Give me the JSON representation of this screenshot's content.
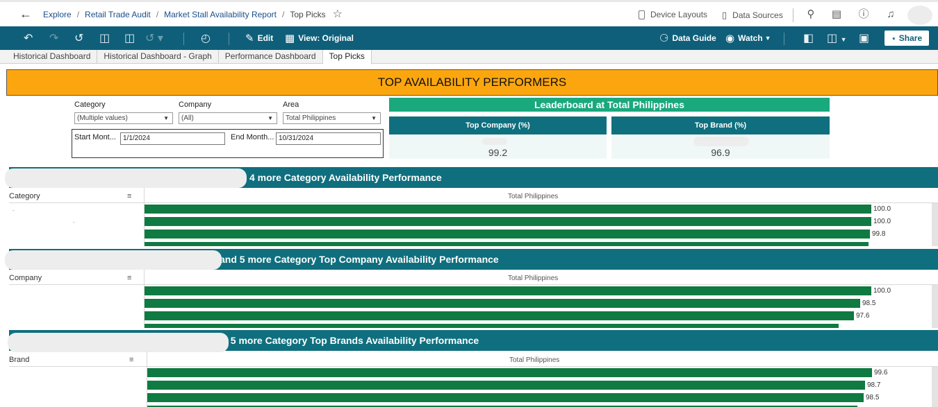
{
  "topbar": {
    "breadcrumbs": [
      "Explore",
      "Retail Trade Audit",
      "Market Stall Availability Report"
    ],
    "current": "Top Picks",
    "device_layouts": "Device Layouts",
    "data_sources": "Data Sources"
  },
  "toolbar": {
    "edit": "Edit",
    "view": "View: Original",
    "data_guide": "Data Guide",
    "watch": "Watch",
    "share": "Share"
  },
  "tabs": [
    "Historical Dashboard",
    "Historical Dashboard - Graph",
    "Performance Dashboard",
    "Top Picks"
  ],
  "dashboard": {
    "title": "TOP AVAILABILITY PERFORMERS",
    "filters": {
      "category_label": "Category",
      "category_value": "(Multiple values)",
      "company_label": "Company",
      "company_value": "(All)",
      "area_label": "Area",
      "area_value": "Total Philippines",
      "start_label": "Start Mont...",
      "start_value": "1/1/2024",
      "end_label": "End Month...",
      "end_value": "10/31/2024"
    },
    "leaderboard": {
      "title": "Leaderboard at Total Philippines",
      "company_head": "Top Company (%)",
      "company_value": "99.2",
      "brand_head": "Top Brand (%)",
      "brand_value": "96.9"
    },
    "sections": [
      {
        "title": "4 more Category Availability Performance",
        "row_header": "Category",
        "col_header": "Total Philippines",
        "values": [
          100.0,
          100.0,
          99.8,
          99.6
        ],
        "labels": [
          "100.0",
          "100.0",
          "99.8"
        ]
      },
      {
        "title": "and 5 more Category Top Company Availability Performance",
        "row_header": "Company",
        "col_header": "Total Philippines",
        "values": [
          100.0,
          98.5,
          97.6,
          95.5
        ],
        "labels": [
          "100.0",
          "98.5",
          "97.6"
        ]
      },
      {
        "title": "and 5 more Category Top Brands Availability Performance",
        "row_header": "Brand",
        "col_header": "Total Philippines",
        "values": [
          99.6,
          98.7,
          98.5,
          97.6
        ],
        "labels": [
          "99.6",
          "98.7",
          "98.5"
        ]
      }
    ]
  },
  "colors": {
    "toolbar": "#0f5f7a",
    "title_bg": "#fca60f",
    "leader_title": "#1aa87d",
    "section_bg": "#0f6f7e",
    "bar": "#0f7a41"
  }
}
